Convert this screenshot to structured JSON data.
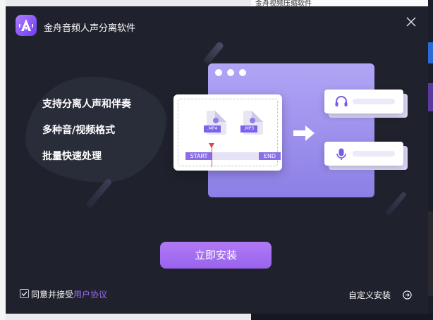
{
  "window": {
    "title": "金舟音频人声分离软件"
  },
  "features": [
    "支持分离人声和伴奏",
    "多种音/视频格式",
    "批量快速处理"
  ],
  "illustration": {
    "file1_tag": ".MP4",
    "file2_tag": ".MP3",
    "timeline_start": "START",
    "timeline_end": "END"
  },
  "actions": {
    "install_label": "立即安装",
    "agree_prefix": "同意并接受",
    "agree_link": "用户协议",
    "agree_checked": true,
    "custom_install_label": "自定义安装"
  },
  "background": {
    "top_fragment": "金舟视频压缩软件"
  },
  "colors": {
    "window_bg": "#1f212c",
    "accent": "#9b6af5",
    "button": "#a36ff1"
  },
  "icons": {
    "logo": "audio-logo-icon",
    "close": "close-icon",
    "headphone": "headphone-icon",
    "mic": "microphone-icon",
    "arrow": "arrow-right-icon",
    "custom": "circle-arrow-right-icon"
  }
}
